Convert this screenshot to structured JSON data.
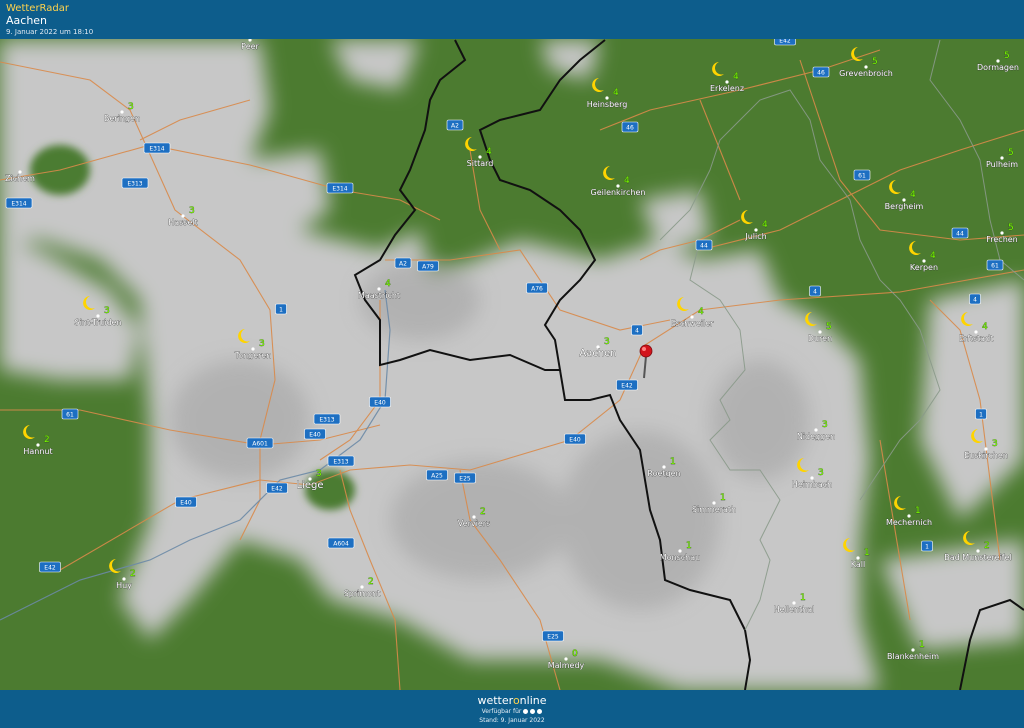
{
  "header": {
    "app_name": "WetterRadar",
    "location": "Aachen",
    "timestamp": "9. Januar 2022 um 18:10"
  },
  "footer": {
    "brand_before": "wetter",
    "brand_o": "o",
    "brand_after": "nline",
    "validity_label": "Verfügbar für",
    "stand": "Stand: 9. Januar 2022"
  },
  "colors": {
    "header_bg": "#0d5d8c",
    "land_green": "#4a7a2f",
    "cloud_gray": "#c9c9c9",
    "road": "#d98a4a",
    "border": "#1a1a1a",
    "moon": "#ffd400",
    "temp_green": "#7cfc00"
  },
  "markers": [
    {
      "id": "aachen-pin",
      "icon": "red-pin-icon"
    }
  ],
  "cities": [
    {
      "name": "Peer",
      "temp": "",
      "moon": false
    },
    {
      "name": "Beringen",
      "temp": "3",
      "moon": false
    },
    {
      "name": "Zichem",
      "temp": "",
      "moon": false
    },
    {
      "name": "Hasselt",
      "temp": "3",
      "moon": false
    },
    {
      "name": "Sint-Truiden",
      "temp": "3",
      "moon": true
    },
    {
      "name": "Tongeren",
      "temp": "3",
      "moon": true
    },
    {
      "name": "Hannut",
      "temp": "2",
      "moon": true
    },
    {
      "name": "Huy",
      "temp": "2",
      "moon": true
    },
    {
      "name": "Liege",
      "temp": "3",
      "moon": false
    },
    {
      "name": "Maastricht",
      "temp": "4",
      "moon": false
    },
    {
      "name": "Sittard",
      "temp": "4",
      "moon": true
    },
    {
      "name": "Heinsberg",
      "temp": "4",
      "moon": true
    },
    {
      "name": "Erkelenz",
      "temp": "4",
      "moon": true
    },
    {
      "name": "Grevenbroich",
      "temp": "5",
      "moon": true
    },
    {
      "name": "Dormagen",
      "temp": "5",
      "moon": false
    },
    {
      "name": "Geilenkirchen",
      "temp": "4",
      "moon": true
    },
    {
      "name": "Pulheim",
      "temp": "5",
      "moon": false
    },
    {
      "name": "Bergheim",
      "temp": "4",
      "moon": true
    },
    {
      "name": "Julich",
      "temp": "4",
      "moon": true
    },
    {
      "name": "Frechen",
      "temp": "5",
      "moon": false
    },
    {
      "name": "Kerpen",
      "temp": "4",
      "moon": true
    },
    {
      "name": "Aachen",
      "temp": "3",
      "moon": false
    },
    {
      "name": "Eschweiler",
      "temp": "4",
      "moon": true
    },
    {
      "name": "Duren",
      "temp": "5",
      "moon": true
    },
    {
      "name": "Erftstadt",
      "temp": "4",
      "moon": true
    },
    {
      "name": "Verviers",
      "temp": "2",
      "moon": false
    },
    {
      "name": "Roetgen",
      "temp": "1",
      "moon": false
    },
    {
      "name": "Simmerath",
      "temp": "1",
      "moon": false
    },
    {
      "name": "Nideggen",
      "temp": "3",
      "moon": false
    },
    {
      "name": "Euskirchen",
      "temp": "3",
      "moon": true
    },
    {
      "name": "Heimbach",
      "temp": "3",
      "moon": true
    },
    {
      "name": "Mechernich",
      "temp": "1",
      "moon": true
    },
    {
      "name": "Monschau",
      "temp": "1",
      "moon": false
    },
    {
      "name": "Kall",
      "temp": "1",
      "moon": true
    },
    {
      "name": "Bad Munstereifel",
      "temp": "2",
      "moon": true
    },
    {
      "name": "Sprimont",
      "temp": "2",
      "moon": false
    },
    {
      "name": "Hellenthal",
      "temp": "1",
      "moon": false
    },
    {
      "name": "Blankenheim",
      "temp": "1",
      "moon": false
    },
    {
      "name": "Malmedy",
      "temp": "0",
      "moon": false
    }
  ],
  "road_labels": [
    "A2",
    "E314",
    "E313",
    "E314",
    "E314",
    "61",
    "46",
    "46",
    "A2",
    "A79",
    "A76",
    "4",
    "44",
    "4",
    "61",
    "4",
    "1",
    "61",
    "E313",
    "E40",
    "A601",
    "E313",
    "E40",
    "A25",
    "E25",
    "E40",
    "E42",
    "E40",
    "A604",
    "E42",
    "E25",
    "E42",
    "44",
    "1",
    "1",
    "E42"
  ]
}
